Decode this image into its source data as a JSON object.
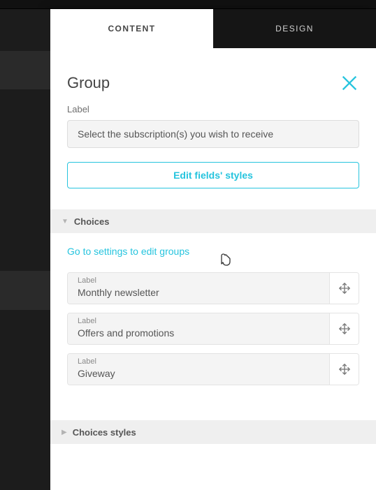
{
  "tabs": {
    "content": "CONTENT",
    "design": "DESIGN"
  },
  "header": {
    "title": "Group"
  },
  "label_field": {
    "caption": "Label",
    "value": "Select the subscription(s) you wish to receive"
  },
  "edit_styles_button": "Edit fields' styles",
  "sections": {
    "choices": "Choices",
    "choices_styles": "Choices styles"
  },
  "settings_link": "Go to settings to edit groups",
  "choice_label_caption": "Label",
  "choices": [
    {
      "label": "Monthly newsletter"
    },
    {
      "label": "Offers and promotions"
    },
    {
      "label": "Giveway"
    }
  ]
}
